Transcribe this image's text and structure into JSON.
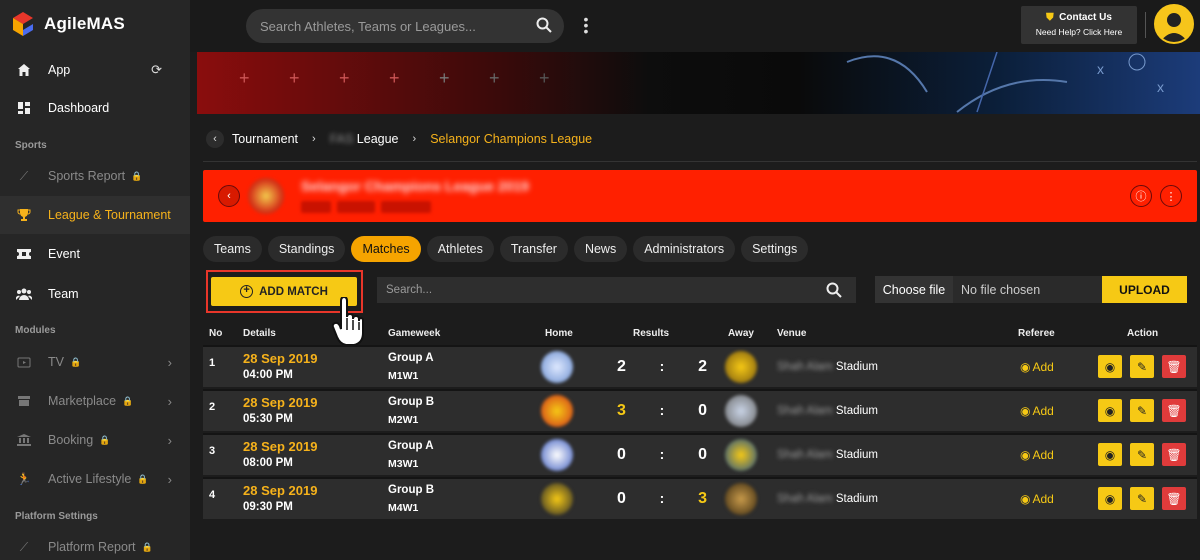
{
  "app": {
    "name": "AgileMAS"
  },
  "sidebar": {
    "items": [
      {
        "label": "App",
        "icon": "home-icon"
      },
      {
        "label": "Dashboard",
        "icon": "dashboard-icon"
      },
      {
        "label": "Sports Report",
        "icon": "trending-icon"
      },
      {
        "label": "League & Tournament",
        "icon": "trophy-icon"
      },
      {
        "label": "Event",
        "icon": "ticket-icon"
      },
      {
        "label": "Team",
        "icon": "team-icon"
      },
      {
        "label": "TV",
        "icon": "tv-icon"
      },
      {
        "label": "Marketplace",
        "icon": "store-icon"
      },
      {
        "label": "Booking",
        "icon": "bank-icon"
      },
      {
        "label": "Active Lifestyle",
        "icon": "running-icon"
      },
      {
        "label": "Platform Report",
        "icon": "trending-icon"
      }
    ],
    "sections": {
      "sports": "Sports",
      "modules": "Modules",
      "platform": "Platform Settings"
    }
  },
  "topbar": {
    "search_placeholder": "Search Athletes, Teams or Leagues...",
    "contact_title": "Contact Us",
    "contact_sub": "Need Help? Click Here"
  },
  "breadcrumb": {
    "item1": "Tournament",
    "item2_blur": "FAS",
    "item2": "League",
    "item3": "Selangor Champions League"
  },
  "league": {
    "title": "Selangor Champions League 2019"
  },
  "tabs": [
    "Teams",
    "Standings",
    "Matches",
    "Athletes",
    "Transfer",
    "News",
    "Administrators",
    "Settings"
  ],
  "toolbar": {
    "add_label": "ADD MATCH",
    "search_placeholder": "Search...",
    "choose_file": "Choose file",
    "no_file": "No file chosen",
    "upload": "UPLOAD"
  },
  "table": {
    "headers": {
      "no": "No",
      "details": "Details",
      "gameweek": "Gameweek",
      "home": "Home",
      "results": "Results",
      "away": "Away",
      "venue": "Venue",
      "referee": "Referee",
      "action": "Action"
    },
    "rows": [
      {
        "no": "1",
        "date": "28 Sep 2019",
        "time": "04:00 PM",
        "group": "Group A",
        "week": "M1W1",
        "home_score": "2",
        "away_score": "2",
        "winner": "none",
        "venue_blur": "Shah Alam",
        "venue": "Stadium",
        "referee": "Add"
      },
      {
        "no": "2",
        "date": "28 Sep 2019",
        "time": "05:30 PM",
        "group": "Group B",
        "week": "M2W1",
        "home_score": "3",
        "away_score": "0",
        "winner": "home",
        "venue_blur": "Shah Alam",
        "venue": "Stadium",
        "referee": "Add"
      },
      {
        "no": "3",
        "date": "28 Sep 2019",
        "time": "08:00 PM",
        "group": "Group A",
        "week": "M3W1",
        "home_score": "0",
        "away_score": "0",
        "winner": "none",
        "venue_blur": "Shah Alam",
        "venue": "Stadium",
        "referee": "Add"
      },
      {
        "no": "4",
        "date": "28 Sep 2019",
        "time": "09:30 PM",
        "group": "Group B",
        "week": "M4W1",
        "home_score": "0",
        "away_score": "3",
        "winner": "away",
        "venue_blur": "Shah Alam",
        "venue": "Stadium",
        "referee": "Add"
      }
    ]
  },
  "colors": {
    "accent": "#f6b21b",
    "button": "#f6c915",
    "league_bar": "#ff2000",
    "delete": "#e03b3b"
  }
}
